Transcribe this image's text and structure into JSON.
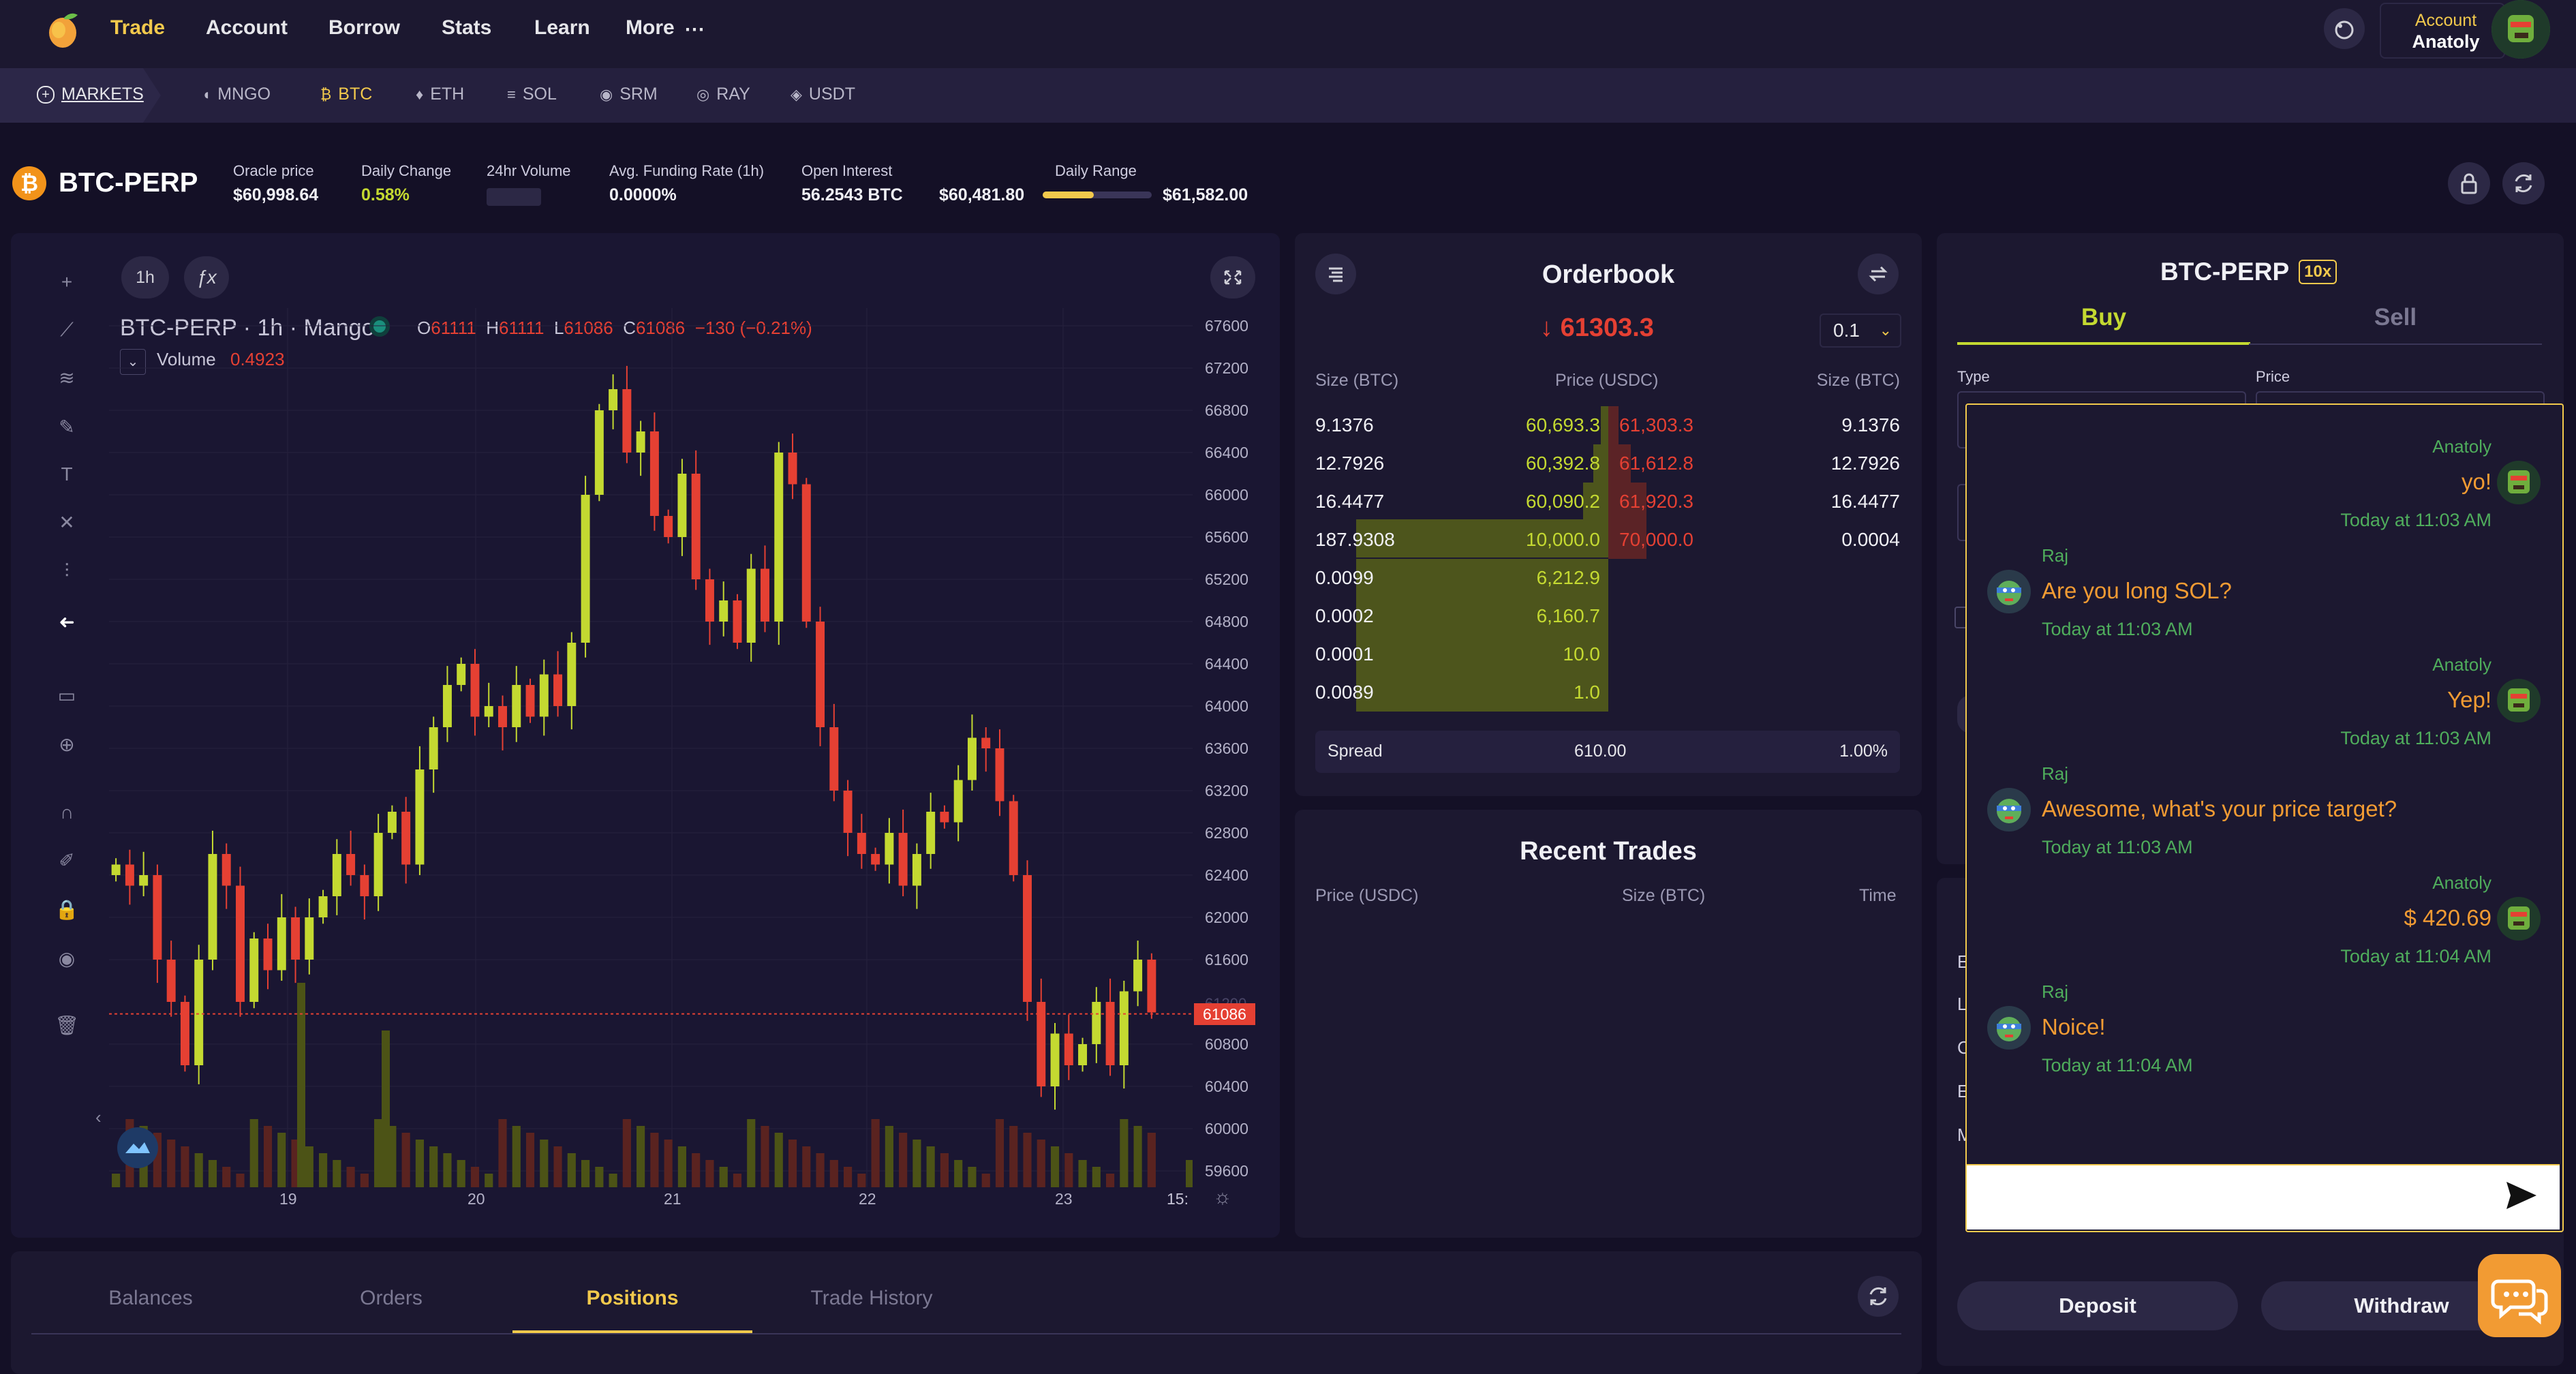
{
  "nav": {
    "items": [
      "Trade",
      "Account",
      "Borrow",
      "Stats",
      "Learn",
      "More"
    ],
    "account_label": "Account",
    "account_name": "Anatoly"
  },
  "markets": {
    "markets_label": "MARKETS",
    "items": [
      "MNGO",
      "BTC",
      "ETH",
      "SOL",
      "SRM",
      "RAY",
      "USDT"
    ],
    "active": "BTC"
  },
  "header": {
    "market": "BTC-PERP",
    "stats": [
      {
        "label": "Oracle price",
        "value": "$60,998.64"
      },
      {
        "label": "Daily Change",
        "value": "0.58%"
      },
      {
        "label": "24hr Volume",
        "value": ""
      },
      {
        "label": "Avg. Funding Rate (1h)",
        "value": "0.0000%"
      },
      {
        "label": "Open Interest",
        "value": "56.2543 BTC"
      }
    ],
    "daily_range_label": "Daily Range",
    "range_low": "$60,481.80",
    "range_high": "$61,582.00",
    "range_position": 0.47
  },
  "chart": {
    "interval_button": "1h",
    "title": "BTC-PERP · 1h · Mango",
    "ohlc": {
      "o": "61111",
      "h": "61111",
      "l": "61086",
      "c": "61086",
      "change": "−130 (−0.21%)"
    },
    "volume_label": "Volume",
    "volume_value": "0.4923",
    "current_price_label": "61086",
    "hidden_price_label": "61200",
    "time_label": "15:"
  },
  "chart_data": {
    "type": "candlestick",
    "title": "BTC-PERP · 1h · Mango",
    "x_tick_labels": [
      "19",
      "20",
      "21",
      "22",
      "23"
    ],
    "y_tick_labels": [
      "67600",
      "67200",
      "66800",
      "66400",
      "66000",
      "65600",
      "65200",
      "64800",
      "64400",
      "64000",
      "63600",
      "63200",
      "62800",
      "62400",
      "62000",
      "61600",
      "60800",
      "60400",
      "60000",
      "59600"
    ],
    "ylim": [
      59600,
      67600
    ],
    "current_price": 61086,
    "close_path": [
      62500,
      62300,
      62400,
      61600,
      61200,
      60600,
      61600,
      62600,
      62300,
      61200,
      61800,
      61500,
      62000,
      61600,
      62000,
      62200,
      62600,
      62400,
      62200,
      62800,
      63000,
      62500,
      63400,
      63800,
      64200,
      64400,
      63900,
      64000,
      63800,
      64200,
      63900,
      64300,
      64000,
      64600,
      66000,
      66800,
      67000,
      66400,
      66600,
      65800,
      65600,
      66200,
      65200,
      64800,
      65000,
      64600,
      65300,
      64800,
      66400,
      66100,
      64800,
      63800,
      63200,
      62800,
      62600,
      62500,
      62800,
      62300,
      62600,
      63000,
      62900,
      63300,
      63700,
      63600,
      63100,
      62400,
      61200,
      60400,
      60900,
      60600,
      60800,
      61200,
      60600,
      61300,
      61600,
      61100
    ]
  },
  "orderbook": {
    "title": "Orderbook",
    "last_price": "61303.3",
    "grouping": "0.1",
    "headers": [
      "Size (BTC)",
      "Price (USDC)",
      "Price (USDC)",
      "Size (BTC)"
    ],
    "rows": [
      {
        "bid_size": "9.1376",
        "bid_price": "60,693.3",
        "ask_price": "61,303.3",
        "ask_size": "9.1376",
        "bid_depth": 0.03,
        "ask_depth": 0.04
      },
      {
        "bid_size": "12.7926",
        "bid_price": "60,392.8",
        "ask_price": "61,612.8",
        "ask_size": "12.7926",
        "bid_depth": 0.06,
        "ask_depth": 0.09
      },
      {
        "bid_size": "16.4477",
        "bid_price": "60,090.2",
        "ask_price": "61,920.3",
        "ask_size": "16.4477",
        "bid_depth": 0.1,
        "ask_depth": 0.15
      },
      {
        "bid_size": "187.9308",
        "bid_price": "10,000.0",
        "ask_price": "70,000.0",
        "ask_size": "0.0004",
        "bid_depth": 1.0,
        "ask_depth": 0.15
      },
      {
        "bid_size": "0.0099",
        "bid_price": "6,212.9",
        "ask_price": "",
        "ask_size": "",
        "bid_depth": 1.0,
        "ask_depth": 0
      },
      {
        "bid_size": "0.0002",
        "bid_price": "6,160.7",
        "ask_price": "",
        "ask_size": "",
        "bid_depth": 1.0,
        "ask_depth": 0
      },
      {
        "bid_size": "0.0001",
        "bid_price": "10.0",
        "ask_price": "",
        "ask_size": "",
        "bid_depth": 1.0,
        "ask_depth": 0
      },
      {
        "bid_size": "0.0089",
        "bid_price": "1.0",
        "ask_price": "",
        "ask_size": "",
        "bid_depth": 1.0,
        "ask_depth": 0
      }
    ],
    "spread_label": "Spread",
    "spread_value": "610.00",
    "spread_pct": "1.00%"
  },
  "recent_trades": {
    "title": "Recent Trades",
    "headers": [
      "Price (USDC)",
      "Size (BTC)",
      "Time"
    ]
  },
  "trade_form": {
    "title": "BTC-PERP",
    "leverage": "10x",
    "buy": "Buy",
    "sell": "Sell",
    "type_label": "Type",
    "price_label": "Price"
  },
  "chat": {
    "messages": [
      {
        "user": "Anatoly",
        "text": "yo!",
        "time": "Today at 11:03 AM",
        "mine": true
      },
      {
        "user": "Raj",
        "text": "Are you long SOL?",
        "time": "Today at 11:03 AM",
        "mine": false
      },
      {
        "user": "Anatoly",
        "text": "Yep!",
        "time": "Today at 11:03 AM",
        "mine": true
      },
      {
        "user": "Raj",
        "text": "Awesome, what's your price target?",
        "time": "Today at 11:03 AM",
        "mine": false
      },
      {
        "user": "Anatoly",
        "text": "$ 420.69",
        "time": "Today at 11:04 AM",
        "mine": true
      },
      {
        "user": "Raj",
        "text": "Noice!",
        "time": "Today at 11:04 AM",
        "mine": false
      }
    ],
    "input_value": ""
  },
  "account_panel": {
    "partial_labels": [
      "E",
      "L",
      "C",
      "E",
      "M"
    ],
    "deposit": "Deposit",
    "withdraw": "Withdraw"
  },
  "bottom_tabs": {
    "items": [
      "Balances",
      "Orders",
      "Positions",
      "Trade History"
    ],
    "active": "Positions"
  },
  "colors": {
    "accent": "#f2c94c",
    "up": "#c4d931",
    "down": "#e54033",
    "chat_name": "#4fad5c",
    "chat_text": "#f29b33"
  }
}
